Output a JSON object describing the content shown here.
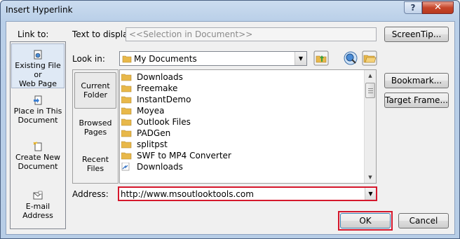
{
  "window": {
    "title": "Insert Hyperlink",
    "help": "?",
    "close": "✕"
  },
  "link_to": {
    "label": "Link to:",
    "items": [
      {
        "line1": "Existing File or",
        "line2": "Web Page",
        "selected": true
      },
      {
        "line1": "Place in This",
        "line2": "Document",
        "selected": false
      },
      {
        "line1": "Create New",
        "line2": "Document",
        "selected": false
      },
      {
        "line1": "E-mail Address",
        "line2": "",
        "selected": false
      }
    ]
  },
  "text_to_display": {
    "label": "Text to display:",
    "value": "<<Selection in Document>>"
  },
  "look_in": {
    "label": "Look in:",
    "value": "My Documents"
  },
  "side_buttons": {
    "screentip": "ScreenTip...",
    "bookmark": "Bookmark...",
    "target_frame": "Target Frame..."
  },
  "folder_tabs": [
    {
      "line1": "Current",
      "line2": "Folder",
      "selected": true
    },
    {
      "line1": "Browsed",
      "line2": "Pages",
      "selected": false
    },
    {
      "line1": "Recent",
      "line2": "Files",
      "selected": false
    }
  ],
  "files": [
    {
      "name": "Downloads",
      "icon": "folder-icon"
    },
    {
      "name": "Freemake",
      "icon": "folder-icon"
    },
    {
      "name": "InstantDemo",
      "icon": "folder-icon"
    },
    {
      "name": "Moyea",
      "icon": "folder-icon"
    },
    {
      "name": "Outlook Files",
      "icon": "folder-icon"
    },
    {
      "name": "PADGen",
      "icon": "folder-icon"
    },
    {
      "name": "splitpst",
      "icon": "folder-icon"
    },
    {
      "name": "SWF to MP4 Converter",
      "icon": "folder-icon"
    },
    {
      "name": "Downloads",
      "icon": "shortcut-icon"
    }
  ],
  "address": {
    "label": "Address:",
    "value": "http://www.msoutlooktools.com"
  },
  "footer": {
    "ok": "OK",
    "cancel": "Cancel"
  },
  "colors": {
    "highlight": "#d5182c",
    "folder": "#e8b84a"
  }
}
